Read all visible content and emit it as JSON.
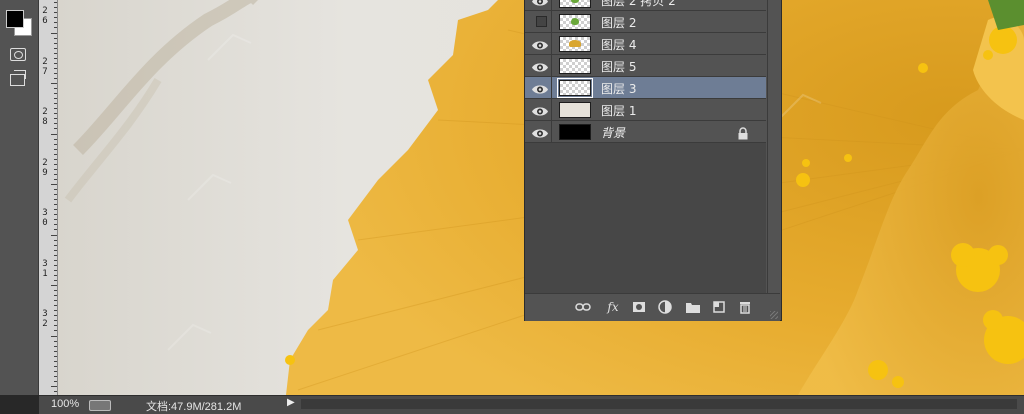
{
  "layers_panel": {
    "layers": [
      {
        "name": "图层 2 拷贝 2",
        "visible": true,
        "thumb": "checker-leaf",
        "selected": false
      },
      {
        "name": "图层 2",
        "visible": false,
        "thumb": "checker-leaf",
        "selected": false
      },
      {
        "name": "图层 4",
        "visible": true,
        "thumb": "checker-ginkgo",
        "selected": false
      },
      {
        "name": "图层 5",
        "visible": true,
        "thumb": "checker",
        "selected": false
      },
      {
        "name": "图层 3",
        "visible": true,
        "thumb": "checker",
        "selected": true
      },
      {
        "name": "图层 1",
        "visible": true,
        "thumb": "paper",
        "selected": false
      },
      {
        "name": "背景",
        "visible": true,
        "thumb": "black",
        "selected": false,
        "locked": true
      }
    ],
    "footer_buttons": [
      "link-layers-icon",
      "fx-icon",
      "add-mask-icon",
      "adjustment-layer-icon",
      "new-group-icon",
      "new-layer-icon",
      "delete-layer-icon"
    ],
    "fx_label": "fx"
  },
  "ruler": {
    "labels": [
      {
        "digits": [
          "2",
          "6"
        ]
      },
      {
        "digits": [
          "2",
          "7"
        ]
      },
      {
        "digits": [
          "2",
          "8"
        ]
      },
      {
        "digits": [
          "2",
          "9"
        ]
      },
      {
        "digits": [
          "3",
          "0"
        ]
      },
      {
        "digits": [
          "3",
          "1"
        ]
      },
      {
        "digits": [
          "3",
          "2"
        ]
      }
    ]
  },
  "status_bar": {
    "zoom": "100%",
    "doc_info": "文档:47.9M/281.2M"
  },
  "colors": {
    "ui_dark": "#535353",
    "panel_bg": "#474747",
    "selection": "#6e7d95",
    "ginkgo_yellow": "#e7a829",
    "paper": "#e4e2dd"
  }
}
